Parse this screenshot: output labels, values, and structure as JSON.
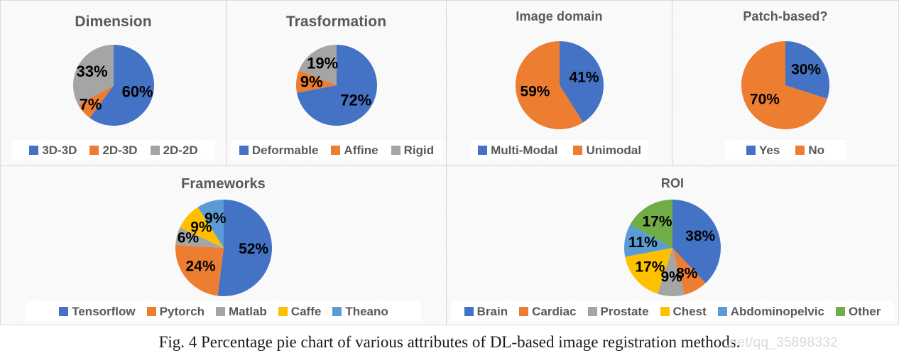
{
  "figure": {
    "caption": "Fig. 4 Percentage pie chart of various attributes of DL-based image registration methods.",
    "watermark": ".net/qq_35898332"
  },
  "palette": {
    "blue": "#4472C4",
    "orange": "#ED7D31",
    "gray": "#A5A5A5",
    "yellow": "#FFC000",
    "light_blue": "#5B9BD5",
    "green": "#70AD47",
    "title_color": "#595959",
    "label_color": "#000000",
    "background": "#FBFBFB",
    "divider": "#D4D4D4"
  },
  "chart_data": [
    {
      "id": "dimension",
      "type": "pie",
      "title": "Dimension",
      "categories": [
        "3D-3D",
        "2D-3D",
        "2D-2D"
      ],
      "values": [
        60,
        7,
        33
      ],
      "value_labels": [
        "60%",
        "7%",
        "33%"
      ],
      "colors": [
        "#4472C4",
        "#ED7D31",
        "#A5A5A5"
      ],
      "legend_position": "bottom",
      "unit": "%"
    },
    {
      "id": "transformation",
      "type": "pie",
      "title": "Trasformation",
      "categories": [
        "Deformable",
        "Affine",
        "Rigid"
      ],
      "values": [
        72,
        9,
        19
      ],
      "value_labels": [
        "72%",
        "9%",
        "19%"
      ],
      "colors": [
        "#4472C4",
        "#ED7D31",
        "#A5A5A5"
      ],
      "legend_position": "bottom",
      "unit": "%"
    },
    {
      "id": "image-domain",
      "type": "pie",
      "title": "Image domain",
      "categories": [
        "Multi-Modal",
        "Unimodal"
      ],
      "values": [
        41,
        59
      ],
      "value_labels": [
        "41%",
        "59%"
      ],
      "colors": [
        "#4472C4",
        "#ED7D31"
      ],
      "legend_position": "bottom",
      "unit": "%"
    },
    {
      "id": "patch-based",
      "type": "pie",
      "title": "Patch-based?",
      "categories": [
        "Yes",
        "No"
      ],
      "values": [
        30,
        70
      ],
      "value_labels": [
        "30%",
        "70%"
      ],
      "colors": [
        "#4472C4",
        "#ED7D31"
      ],
      "legend_position": "bottom",
      "unit": "%"
    },
    {
      "id": "frameworks",
      "type": "pie",
      "title": "Frameworks",
      "categories": [
        "Tensorflow",
        "Pytorch",
        "Matlab",
        "Caffe",
        "Theano"
      ],
      "values": [
        52,
        24,
        6,
        9,
        9
      ],
      "value_labels": [
        "52%",
        "24%",
        "6%",
        "9%",
        "9%"
      ],
      "colors": [
        "#4472C4",
        "#ED7D31",
        "#A5A5A5",
        "#FFC000",
        "#5B9BD5"
      ],
      "legend_position": "bottom",
      "unit": "%"
    },
    {
      "id": "roi",
      "type": "pie",
      "title": "ROI",
      "categories": [
        "Brain",
        "Cardiac",
        "Prostate",
        "Chest",
        "Abdominopelvic",
        "Other"
      ],
      "values": [
        38,
        8,
        9,
        17,
        11,
        17
      ],
      "value_labels": [
        "38%",
        "8%",
        "9%",
        "17%",
        "11%",
        "17%"
      ],
      "colors": [
        "#4472C4",
        "#ED7D31",
        "#A5A5A5",
        "#FFC000",
        "#5B9BD5",
        "#70AD47"
      ],
      "legend_position": "bottom",
      "unit": "%"
    }
  ]
}
